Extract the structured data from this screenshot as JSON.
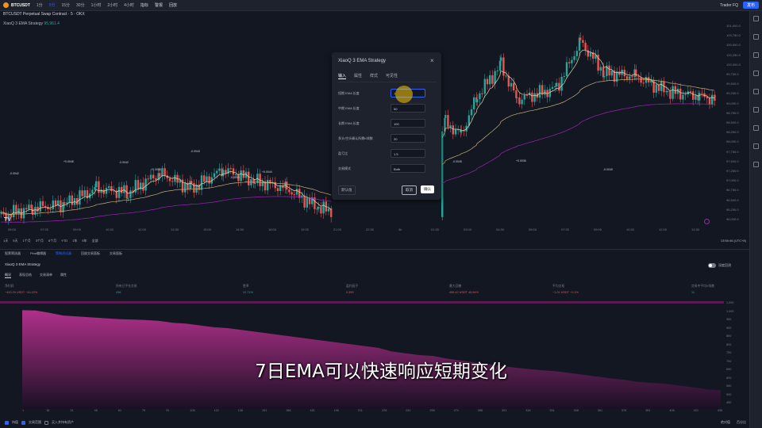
{
  "topbar": {
    "ticker": "BTCUSDT",
    "timeframes": [
      "1分",
      "5分",
      "15分",
      "30分",
      "1小时",
      "2小时",
      "4小时"
    ],
    "active_timeframe": "5分",
    "tools": [
      "指标",
      "警报",
      "回放"
    ],
    "user": "Trader FQ",
    "publish": "发布"
  },
  "chart": {
    "title": "BTCUSDT Perpetual Swap Contract · 5 · OKX",
    "strategy_line_label": "XiaoQ 3 EMA Strategy",
    "strategy_line_value": "95,961.4",
    "price_scale": [
      "101,000.0",
      "100,750.0",
      "100,500.0",
      "100,250.0",
      "100,000.0",
      "99,750.0",
      "99,500.0",
      "99,250.0",
      "99,000.0",
      "98,750.0",
      "98,500.0",
      "98,250.0",
      "98,000.0",
      "97,750.0",
      "97,500.0",
      "97,250.0",
      "97,000.0",
      "96,750.0",
      "96,500.0",
      "96,250.0",
      "96,000.0"
    ],
    "time_axis": [
      "06:00",
      "07:30",
      "09:00",
      "10:30",
      "12:00",
      "13:30",
      "15:00",
      "16:30",
      "18:00",
      "19:30",
      "21:00",
      "22:30",
      "3k",
      "01:30",
      "03:00",
      "04:30",
      "06:00",
      "07:30",
      "09:00",
      "10:30",
      "12:00",
      "13:30"
    ],
    "signal_labels": [
      "-0.0042",
      "+0.0048",
      "-0.0042",
      "+0.0046",
      "-0.0043",
      "-0.0039",
      "+0.0044",
      "-0.0045",
      "+0.0036",
      "-0.0040"
    ],
    "clock": "13:56:46 (UTC+8)",
    "colors": {
      "up": "#26a69a",
      "down": "#ef5350",
      "ema_fast": "#e6d6a8",
      "ema_mid": "#c8b07a",
      "ema_slow": "#9c27b0"
    }
  },
  "rangebar": {
    "ranges": [
      "1天",
      "5天",
      "1个月",
      "3个月",
      "6个月",
      "YTD",
      "1年",
      "5年",
      "全部"
    ],
    "right": "13:56:46 (UTC+8)"
  },
  "panel": {
    "tabs": [
      "股票筛选器",
      "Pine编辑器",
      "策略测试器",
      "回放交易面板",
      "交易面板"
    ],
    "active_tab": "策略测试器",
    "strategy_name": "XiaoQ 3 EMA Strategy",
    "replay_label": "深度回测",
    "subtabs": [
      "概况",
      "表现总结",
      "交易清单",
      "属性"
    ],
    "active_subtab": "概况",
    "metrics": [
      {
        "label": "净利润",
        "value": "−442.20 USDT  −44.22%",
        "positive": false
      },
      {
        "label": "所有已平仓交易",
        "value": "436",
        "positive": true
      },
      {
        "label": "胜率",
        "value": "22.71%",
        "positive": true
      },
      {
        "label": "盈利因子",
        "value": "0.399",
        "positive": false
      },
      {
        "label": "最大回撤",
        "value": "455.42 USDT  45.54%",
        "positive": false
      },
      {
        "label": "平均交易",
        "value": "−1.01 USDT  −0.1%",
        "positive": false
      },
      {
        "label": "交易中平均K线数",
        "value": "11",
        "positive": true
      }
    ],
    "equity_scale": [
      "1,050",
      "1,000",
      "950",
      "900",
      "850",
      "800",
      "750",
      "700",
      "650",
      "600",
      "550",
      "500",
      "450"
    ],
    "equity_axis": [
      "1",
      "16",
      "31",
      "46",
      "61",
      "76",
      "91",
      "106",
      "121",
      "136",
      "151",
      "166",
      "181",
      "196",
      "211",
      "226",
      "241",
      "256",
      "271",
      "286",
      "301",
      "316",
      "331",
      "346",
      "361",
      "376",
      "391",
      "406",
      "421",
      "436"
    ],
    "equity_curve": [
      1000,
      998,
      985,
      970,
      965,
      960,
      955,
      950,
      948,
      945,
      940,
      930,
      925,
      915,
      905,
      900,
      890,
      880,
      870,
      860,
      850,
      840,
      830,
      820,
      810,
      800,
      790,
      770,
      760,
      750,
      745,
      730,
      720,
      710,
      700,
      690,
      680,
      672,
      665,
      660,
      650,
      640,
      630,
      620,
      612,
      600,
      595,
      590,
      580,
      570,
      560,
      555
    ],
    "bottom": {
      "opt1": "持值",
      "opt2": "交易范围",
      "opt3": "买入并持有资产",
      "right1": "绝对值",
      "right2": "百分比"
    }
  },
  "dialog": {
    "title": "XiaoQ 3 EMA Strategy",
    "tabs": [
      "输入",
      "属性",
      "样式",
      "可见性"
    ],
    "active_tab": "输入",
    "rows": [
      {
        "label": "短期 EMA 长度",
        "value": "7"
      },
      {
        "label": "中期 EMA 长度",
        "value": "50"
      },
      {
        "label": "长期 EMA 长度",
        "value": "100"
      },
      {
        "label": "多头/空头确认所需K线数",
        "value": "20"
      },
      {
        "label": "盈亏比",
        "value": "1.5"
      },
      {
        "label": "交易模式",
        "value": "Both"
      }
    ],
    "defaults": "默认值",
    "cancel": "取消",
    "ok": "确认"
  },
  "subtitle": "7日EMA可以快速响应短期变化"
}
